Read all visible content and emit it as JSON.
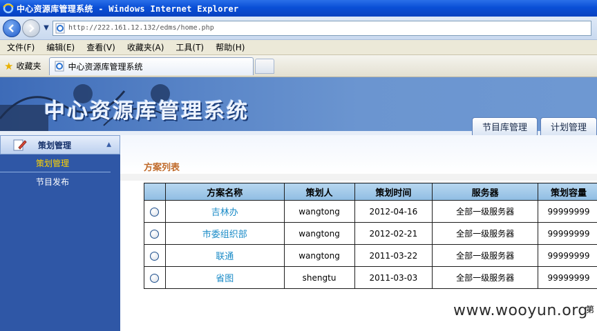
{
  "window": {
    "title": "中心资源库管理系统 - Windows Internet Explorer",
    "url": "http://222.161.12.132/edms/home.php"
  },
  "menu": [
    "文件(F)",
    "编辑(E)",
    "查看(V)",
    "收藏夹(A)",
    "工具(T)",
    "帮助(H)"
  ],
  "favorites": {
    "label": "收藏夹",
    "tab_title": "中心资源库管理系统"
  },
  "site": {
    "title": "中心资源库管理系统",
    "nav_tabs": [
      "节目库管理",
      "计划管理"
    ]
  },
  "sidebar": {
    "header": "策划管理",
    "items": [
      {
        "label": "策划管理",
        "active": true
      },
      {
        "label": "节目发布",
        "active": false
      }
    ]
  },
  "content": {
    "section_title": "方案列表",
    "table": {
      "headers": [
        "方案名称",
        "策划人",
        "策划时间",
        "服务器",
        "策划容量"
      ],
      "rows": [
        {
          "name": "吉林办",
          "planner": "wangtong",
          "date": "2012-04-16",
          "server": "全部一级服务器",
          "capacity": "99999999"
        },
        {
          "name": "市委组织部",
          "planner": "wangtong",
          "date": "2012-02-21",
          "server": "全部一级服务器",
          "capacity": "99999999"
        },
        {
          "name": "联通",
          "planner": "wangtong",
          "date": "2011-03-22",
          "server": "全部一级服务器",
          "capacity": "99999999"
        },
        {
          "name": "省图",
          "planner": "shengtu",
          "date": "2011-03-03",
          "server": "全部一级服务器",
          "capacity": "99999999"
        }
      ]
    },
    "corner_text": "第"
  },
  "watermark": "www.wooyun.org",
  "colors": {
    "titlebar": "#0a4fd6",
    "banner": "#5a86c8",
    "sidebar": "#2f57a6",
    "section_title": "#c06a2a",
    "link": "#1a8bc7",
    "active_side_item": "#ffd400"
  },
  "icons": [
    "ie-logo-icon",
    "back-arrow-icon",
    "forward-arrow-icon",
    "page-icon",
    "favorites-star-icon",
    "pencil-icon",
    "collapse-up-icon",
    "radio-icon"
  ]
}
